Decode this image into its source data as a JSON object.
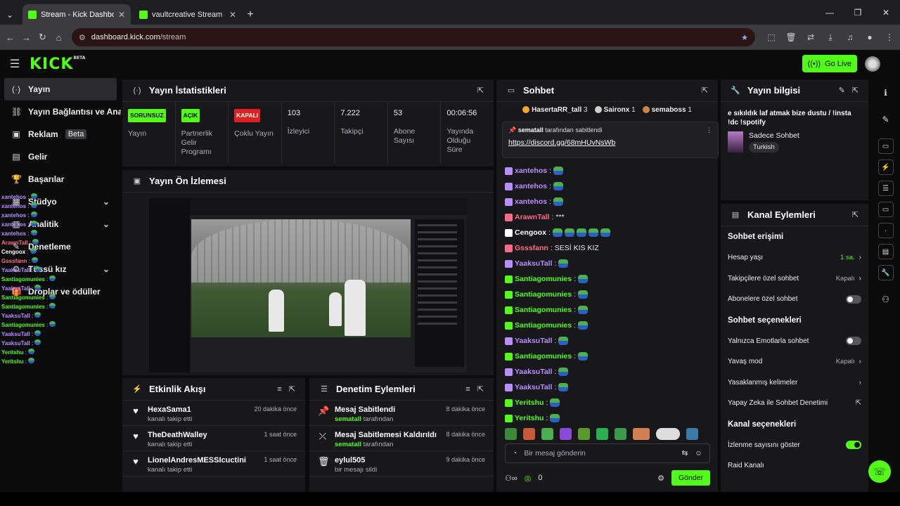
{
  "browser": {
    "tabs": [
      {
        "title": "Stream - Kick Dashboard",
        "active": true
      },
      {
        "title": "vaultcreative Stream - Watch Li",
        "active": false
      }
    ],
    "url_host": "dashboard.kick.com",
    "url_path": "/stream"
  },
  "header": {
    "logo": "KICK",
    "logo_sup": "BETA",
    "go_live": "Go Live"
  },
  "sidebar": {
    "items": [
      {
        "label": "Yayın",
        "icon": "broadcast-icon"
      },
      {
        "label": "Yayın Bağlantısı ve Anahtarı",
        "icon": "link-icon"
      },
      {
        "label": "Reklam",
        "badge": "Beta",
        "icon": "ad-icon"
      },
      {
        "label": "Gelir",
        "icon": "money-icon"
      },
      {
        "label": "Başarılar",
        "icon": "trophy-icon"
      },
      {
        "label": "Stüdyo",
        "icon": "studio-icon"
      },
      {
        "label": "Analitik",
        "icon": "analytics-icon"
      },
      {
        "label": "Denetleme",
        "icon": "moderation-icon"
      },
      {
        "label": "Tüssü kız",
        "icon": "settings-icon"
      },
      {
        "label": "Droplar ve ödüller",
        "icon": "gift-icon"
      }
    ],
    "overlay_chat": [
      {
        "user": "xantehos",
        "color": "#b98cff"
      },
      {
        "user": "xantehos",
        "color": "#b98cff"
      },
      {
        "user": "xantehos",
        "color": "#b98cff"
      },
      {
        "user": "xantehos",
        "color": "#b98cff"
      },
      {
        "user": "xantehos",
        "color": "#b98cff"
      },
      {
        "user": "ArawnTall",
        "color": "#ff6a8a"
      },
      {
        "user": "Cengoox",
        "color": "#ffffff"
      },
      {
        "user": "Gsssfann",
        "color": "#ff6a8a"
      },
      {
        "user": "YaaksuTall",
        "color": "#b98cff"
      },
      {
        "user": "Santiagomunies",
        "color": "#53fc18"
      },
      {
        "user": "YaaksuTall",
        "color": "#b98cff"
      },
      {
        "user": "Santiagomunies",
        "color": "#53fc18"
      },
      {
        "user": "Santiagomunies",
        "color": "#53fc18"
      },
      {
        "user": "YaaksuTall",
        "color": "#b98cff"
      },
      {
        "user": "Santiagomunies",
        "color": "#53fc18"
      },
      {
        "user": "YaaksuTall",
        "color": "#b98cff"
      },
      {
        "user": "YaaksuTall",
        "color": "#b98cff"
      },
      {
        "user": "Yeritshu",
        "color": "#53fc18"
      },
      {
        "user": "Yeritshu",
        "color": "#53fc18"
      }
    ]
  },
  "stats": {
    "title": "Yayın İstatistikleri",
    "items": [
      {
        "badge": "SORUNSUZ",
        "badge_color": "green",
        "label": "Yayın"
      },
      {
        "badge": "AÇIK",
        "badge_color": "green",
        "label": "Partnerlik Gelir Programı"
      },
      {
        "badge": "KAPALI",
        "badge_color": "red",
        "label": "Çoklu Yayın"
      },
      {
        "value": "103",
        "label": "İzleyici"
      },
      {
        "value": "7.222",
        "label": "Takipçi"
      },
      {
        "value": "53",
        "label": "Abone Sayısı"
      },
      {
        "value": "00:06:56",
        "label": "Yayında Olduğu Süre"
      }
    ]
  },
  "preview": {
    "title": "Yayın Ön İzlemesi"
  },
  "activity": {
    "title": "Etkinlik Akışı",
    "rows": [
      {
        "name": "HexaSama1",
        "sub": "kanalı takip etti",
        "time": "20 dakika önce"
      },
      {
        "name": "TheDeathWalley",
        "sub": "kanalı takip etti",
        "time": "1 saat önce"
      },
      {
        "name": "LionelAndresMESSIcuctini",
        "sub": "kanalı takip etti",
        "time": "1 saat önce"
      }
    ]
  },
  "moderation": {
    "title": "Denetim Eylemleri",
    "rows": [
      {
        "name": "Mesaj Sabitlendi",
        "actor": "sematall",
        "sub": "tarafından",
        "time": "8 dakika önce"
      },
      {
        "name": "Mesaj Sabitlemesi Kaldırıldı",
        "actor": "sematall",
        "sub": "tarafından",
        "time": "8 dakika önce"
      },
      {
        "name": "eylul505",
        "actor": "",
        "sub": "bir mesajı sildi",
        "time": "9 dakika önce"
      }
    ]
  },
  "chat": {
    "title": "Sohbet",
    "top_gifters": [
      {
        "name": "HasertaRR_tall",
        "count": "3",
        "color": "#f5a623"
      },
      {
        "name": "Saironx",
        "count": "1",
        "color": "#cfcfcf"
      },
      {
        "name": "semaboss",
        "count": "1",
        "color": "#c8874a"
      }
    ],
    "pinned_by": "sematall",
    "pinned_suffix": "tarafından sabitlendi",
    "pinned_link": "https://discord.gg/68mHUvNsWb",
    "messages": [
      {
        "user": "xantehos",
        "color": "#b98cff",
        "text": "",
        "emotes": 1
      },
      {
        "user": "xantehos",
        "color": "#b98cff",
        "text": "",
        "emotes": 1
      },
      {
        "user": "xantehos",
        "color": "#b98cff",
        "text": "",
        "emotes": 1
      },
      {
        "user": "ArawnTall",
        "color": "#ff6a8a",
        "text": "***",
        "emotes": 0
      },
      {
        "user": "Cengoox",
        "color": "#ffffff",
        "text": "",
        "emotes": 5
      },
      {
        "user": "Gsssfann",
        "color": "#ff6a8a",
        "text": "SESİ KIS KIZ",
        "emotes": 0
      },
      {
        "user": "YaaksuTall",
        "color": "#b98cff",
        "text": "",
        "emotes": 1
      },
      {
        "user": "Santiagomunies",
        "color": "#53fc18",
        "text": "",
        "emotes": 1
      },
      {
        "user": "Santiagomunies",
        "color": "#53fc18",
        "text": "",
        "emotes": 1
      },
      {
        "user": "Santiagomunies",
        "color": "#53fc18",
        "text": "",
        "emotes": 1
      },
      {
        "user": "Santiagomunies",
        "color": "#53fc18",
        "text": "",
        "emotes": 1
      },
      {
        "user": "YaaksuTall",
        "color": "#b98cff",
        "text": "",
        "emotes": 1
      },
      {
        "user": "Santiagomunies",
        "color": "#53fc18",
        "text": "",
        "emotes": 1
      },
      {
        "user": "YaaksuTall",
        "color": "#b98cff",
        "text": "",
        "emotes": 1
      },
      {
        "user": "YaaksuTall",
        "color": "#b98cff",
        "text": "",
        "emotes": 1
      },
      {
        "user": "Yeritshu",
        "color": "#53fc18",
        "text": "",
        "emotes": 1
      },
      {
        "user": "Yeritshu",
        "color": "#53fc18",
        "text": "",
        "emotes": 1
      }
    ],
    "input_placeholder": "Bir mesaj gönderin",
    "points": "0",
    "send": "Gönder"
  },
  "info": {
    "title": "Yayın bilgisi",
    "stream_title": "e sıkıldık laf atmak bize dustu / !insta !dc !spotify",
    "category": "Sadece Sohbet",
    "language": "Turkish"
  },
  "channel_actions": {
    "title": "Kanal Eylemleri",
    "chat_access": "Sohbet erişimi",
    "account_age": "Hesap yaşı",
    "account_age_val": "1 sa.",
    "followers_only": "Takipçilere özel sohbet",
    "followers_only_val": "Kapalı",
    "subs_only": "Abonelere özel sohbet",
    "chat_options": "Sohbet seçenekleri",
    "emote_only": "Yalnızca Emotlarla sohbet",
    "slow_mode": "Yavaş mod",
    "slow_mode_val": "Kapalı",
    "banned_words": "Yasaklanmış kelimeler",
    "ai_moderation": "Yapay Zeka ile Sohbet Denetimi",
    "channel_options": "Kanal seçenekleri",
    "show_viewers": "İzlenme sayısını göster",
    "raid": "Raid Kanalı"
  }
}
